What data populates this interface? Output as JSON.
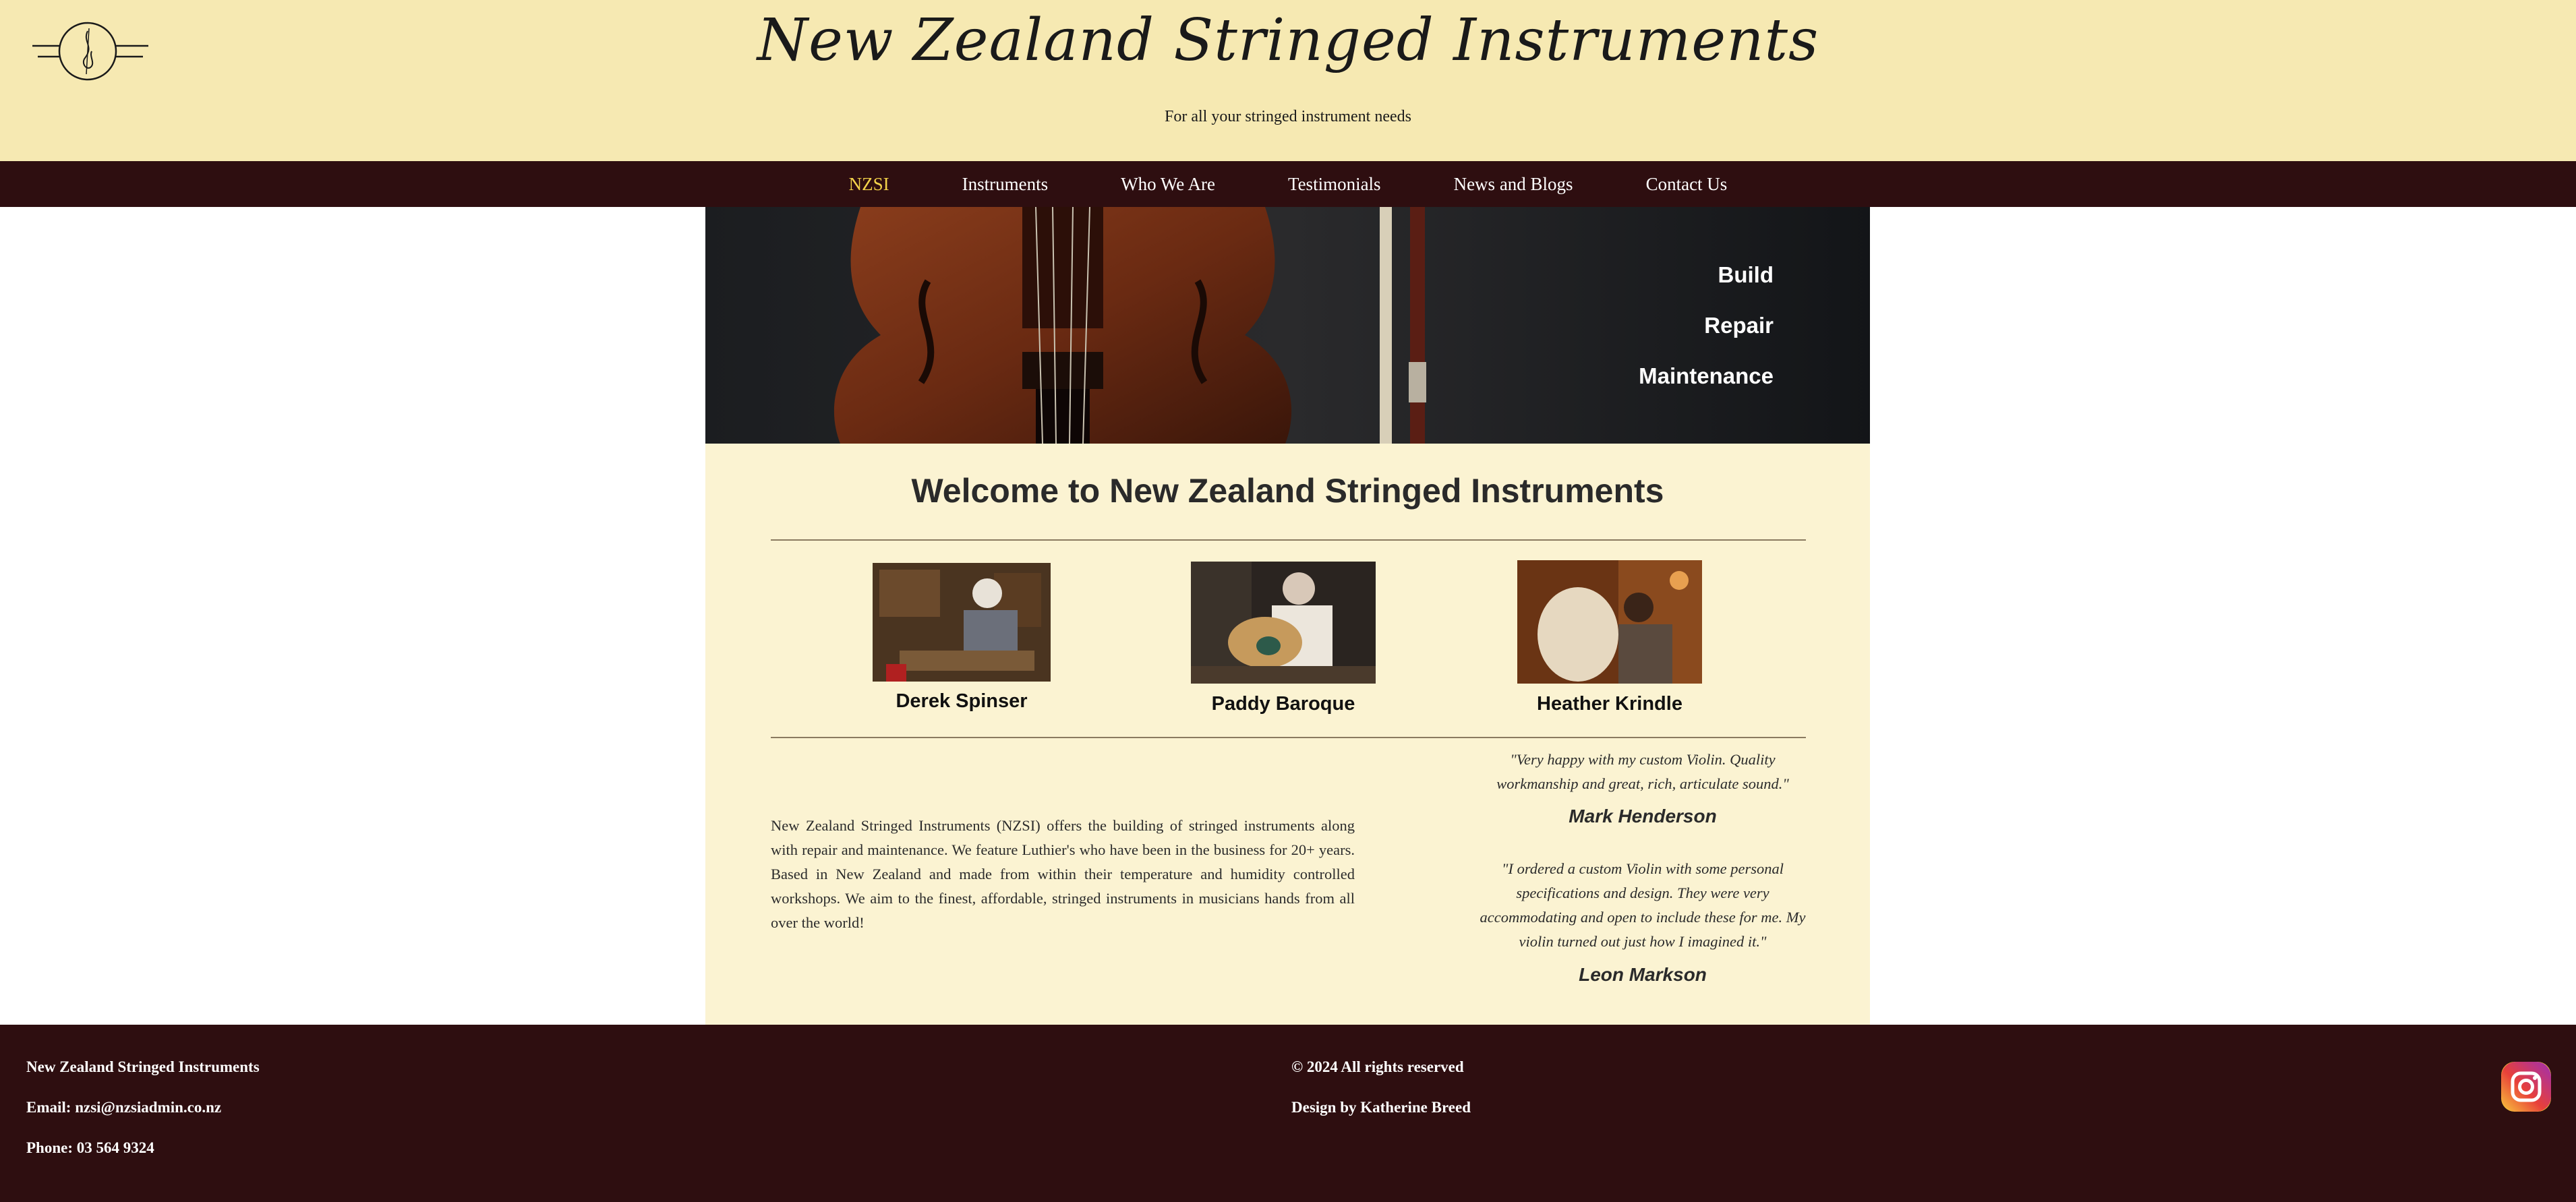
{
  "header": {
    "title": "New Zealand Stringed Instruments",
    "subtitle": "For all your stringed instrument needs",
    "logo_icon": "violin-logo-icon"
  },
  "nav": {
    "items": [
      {
        "label": "NZSI",
        "active": true
      },
      {
        "label": "Instruments",
        "active": false
      },
      {
        "label": "Who We Are",
        "active": false
      },
      {
        "label": "Testimonials",
        "active": false
      },
      {
        "label": "News and Blogs",
        "active": false
      },
      {
        "label": "Contact Us",
        "active": false
      }
    ],
    "active_color": "#f3d34a"
  },
  "banner": {
    "services": [
      "Build",
      "Repair",
      "Maintenance"
    ]
  },
  "main": {
    "welcome_title": "Welcome to New Zealand Stringed Instruments",
    "luthiers": [
      {
        "name": "Derek Spinser"
      },
      {
        "name": "Paddy Baroque"
      },
      {
        "name": "Heather Krindle"
      }
    ],
    "about_text": "New Zealand Stringed Instruments (NZSI) offers the building of stringed instruments along with repair and maintenance. We feature Luthier's who have been in the business for 20+ years. Based in New Zealand and made from within their temperature and humidity controlled workshops. We aim to the finest, affordable, stringed instruments in musicians hands from all over the world!",
    "testimonials": [
      {
        "quote": "\"Very happy with my custom Violin. Quality workmanship and great, rich, articulate sound.\"",
        "author": "Mark Henderson"
      },
      {
        "quote": "\"I ordered a custom Violin with some personal specifications and design. They were very accommodating and open to include these for me. My violin turned out just how I imagined it.\"",
        "author": "Leon Markson"
      }
    ]
  },
  "footer": {
    "company": "New Zealand Stringed Instruments",
    "email": "Email: nzsi@nzsiadmin.co.nz",
    "phone": "Phone: 03 564 9324",
    "copyright": "© 2024 All rights reserved",
    "design_credit": "Design by Katherine Breed",
    "social_icon": "instagram-icon"
  },
  "colors": {
    "header_bg": "#f6e9b2",
    "nav_bg": "#2e0e10",
    "content_bg": "#fbf3d2",
    "footer_bg": "#2e0e10"
  }
}
